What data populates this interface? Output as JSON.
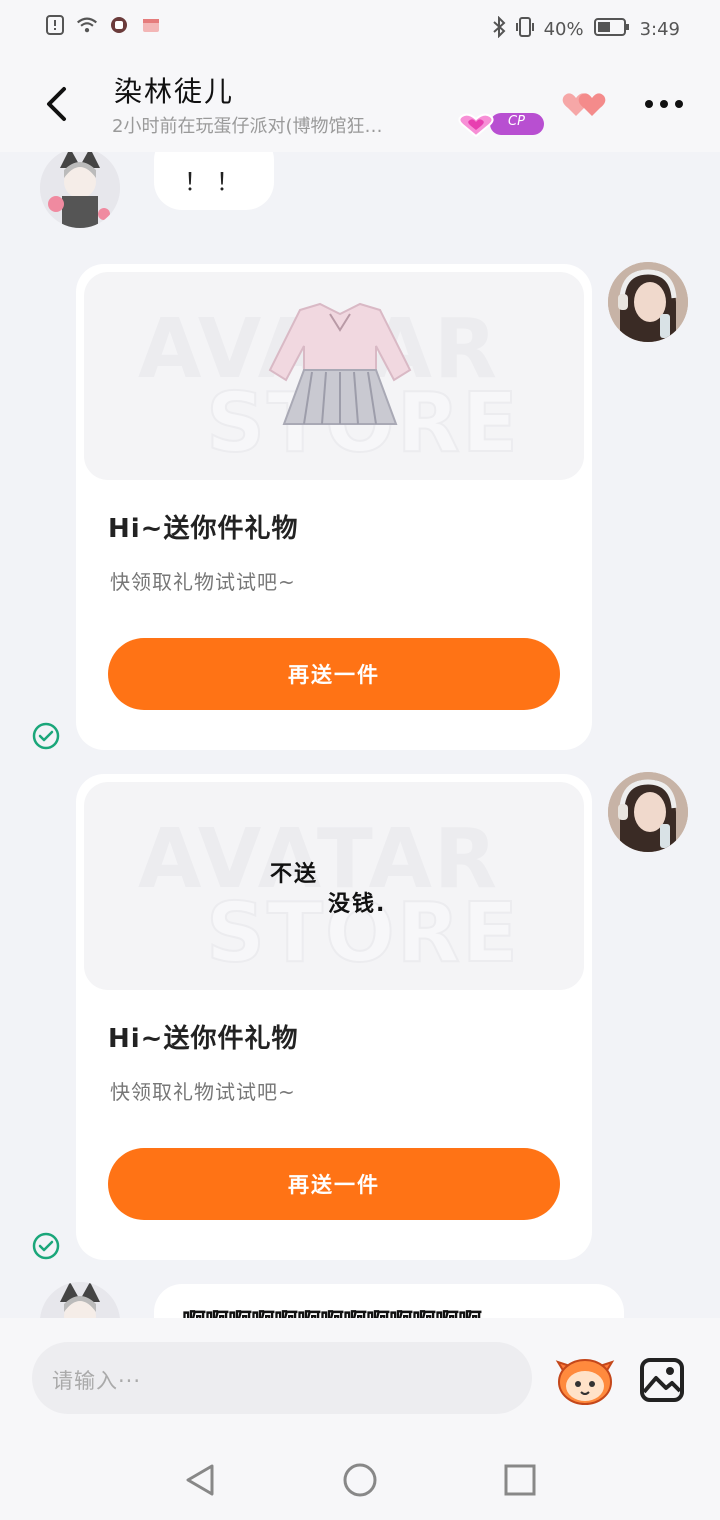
{
  "status_bar": {
    "battery_percent": "40%",
    "time": "3:49"
  },
  "header": {
    "title": "染林徒儿",
    "subtitle": "2小时前在玩蛋仔派对(博物馆狂…",
    "cp_label": "CP"
  },
  "messages": {
    "first_bubble": "！！",
    "card1": {
      "title": "Hi~送你件礼物",
      "subtitle": "快领取礼物试试吧~",
      "button": "再送一件",
      "watermark_top": "AVATAR",
      "watermark_bottom": "STORE"
    },
    "card2": {
      "title": "Hi~送你件礼物",
      "subtitle": "快领取礼物试试吧~",
      "button": "再送一件",
      "watermark_top": "AVATAR",
      "watermark_bottom": "STORE",
      "image_text_1": "不送",
      "image_text_2": "没钱."
    },
    "last_bubble": "啊啊啊啊啊啊啊啊啊啊啊啊啊"
  },
  "input": {
    "placeholder": "请输入···"
  },
  "colors": {
    "accent": "#ff7315",
    "check": "#1aa67a",
    "cp_badge": "#b84fd1"
  }
}
